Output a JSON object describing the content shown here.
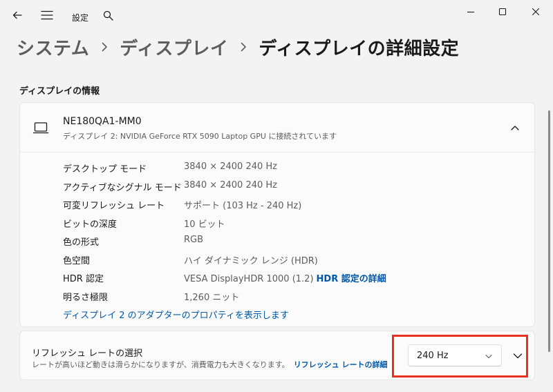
{
  "window": {
    "title": "設定",
    "icons": {
      "back": "back-arrow-icon",
      "menu": "hamburger-menu-icon",
      "search": "search-icon",
      "minimize": "minimize-icon",
      "maximize": "maximize-icon",
      "close": "close-icon"
    }
  },
  "breadcrumb": {
    "items": [
      {
        "label": "システム"
      },
      {
        "label": "ディスプレイ"
      },
      {
        "label": "ディスプレイの詳細設定"
      }
    ]
  },
  "section": {
    "title": "ディスプレイの情報"
  },
  "display": {
    "name": "NE180QA1-MM0",
    "subtitle": "ディスプレイ 2: NVIDIA GeForce RTX 5090 Laptop GPU に接続されています",
    "icon": "laptop-monitor-icon",
    "info": [
      {
        "label": "デスクトップ モード",
        "value": "3840 × 2400 240 Hz"
      },
      {
        "label": "アクティブなシグナル モード",
        "value": "3840 × 2400 240 Hz"
      },
      {
        "label": "可変リフレッシュ レート",
        "value": "サポート (103 Hz - 240 Hz)"
      },
      {
        "label": "ビットの深度",
        "value": "10 ビット"
      },
      {
        "label": "色の形式",
        "value": "RGB"
      },
      {
        "label": "色空間",
        "value": "ハイ ダイナミック レンジ (HDR)"
      },
      {
        "label": "HDR 認定",
        "value": "VESA DisplayHDR 1000 (1.2)",
        "link": "HDR 認定の詳細"
      },
      {
        "label": "明るさ極限",
        "value": "1,260 ニット"
      }
    ],
    "adapter_link": "ディスプレイ 2 のアダプターのプロパティを表示します"
  },
  "refresh_rate": {
    "title": "リフレッシュ レートの選択",
    "description": "レートが高いほど動きは滑らかになりますが、消費電力も大きくなります。",
    "link": "リフレッシュ レートの詳細",
    "selected": "240 Hz"
  },
  "colors": {
    "accent_link": "#0058a8",
    "highlight": "#e8321d"
  }
}
